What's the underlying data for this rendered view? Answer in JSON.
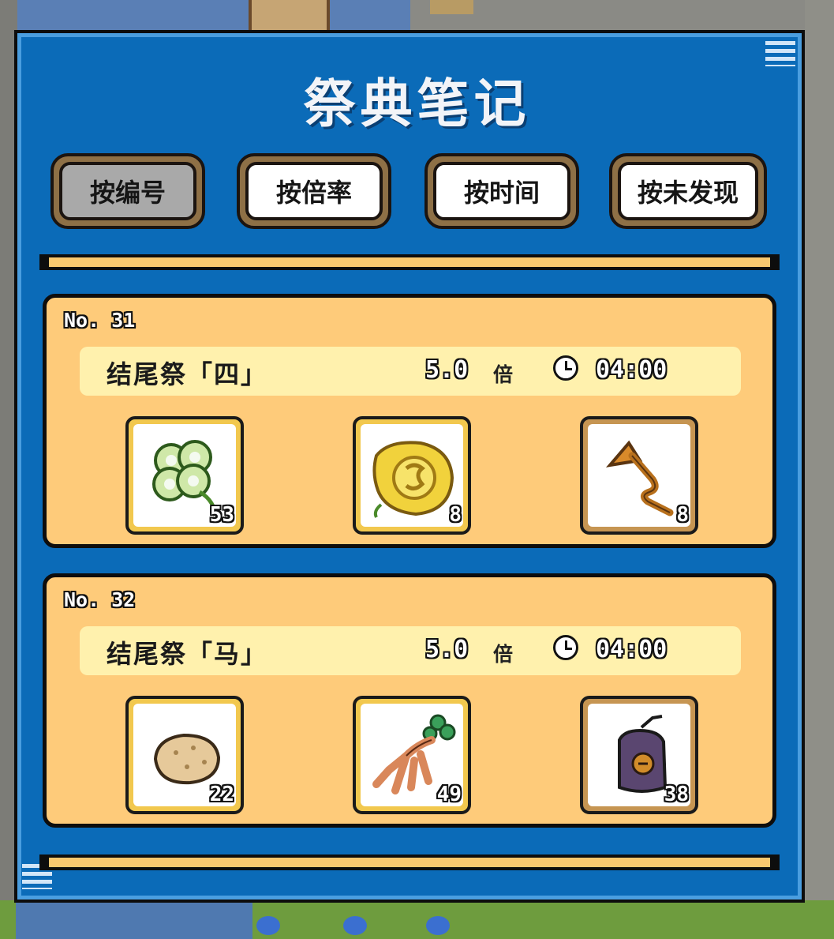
{
  "panel": {
    "title": "祭典笔记"
  },
  "sort_tabs": [
    {
      "label": "按编号",
      "active": true
    },
    {
      "label": "按倍率",
      "active": false
    },
    {
      "label": "按时间",
      "active": false
    },
    {
      "label": "按未发现",
      "active": false
    }
  ],
  "festivals": [
    {
      "number": "No. 31",
      "name": "结尾祭「四」",
      "rate": "5.0",
      "rate_unit": "倍",
      "time": "04:00",
      "items": [
        {
          "icon": "four-leaf-clover-icon",
          "count": "53",
          "frame": "gold"
        },
        {
          "icon": "gold-coin-leaf-icon",
          "count": "8",
          "frame": "gold"
        },
        {
          "icon": "bronze-trumpet-icon",
          "count": "8",
          "frame": "bronze"
        }
      ]
    },
    {
      "number": "No. 32",
      "name": "结尾祭「马」",
      "rate": "5.0",
      "rate_unit": "倍",
      "time": "04:00",
      "items": [
        {
          "icon": "potato-icon",
          "count": "22",
          "frame": "gold"
        },
        {
          "icon": "mandrake-root-icon",
          "count": "49",
          "frame": "gold"
        },
        {
          "icon": "purple-pouch-icon",
          "count": "38",
          "frame": "bronze"
        }
      ]
    }
  ],
  "colors": {
    "panel_blue": "#0b6bb8",
    "card_orange": "#fecb7a",
    "info_bar": "#fff1ad",
    "tab_frame": "#8e7046",
    "slot_gold": "#f2c84e",
    "slot_bronze": "#c69552"
  }
}
